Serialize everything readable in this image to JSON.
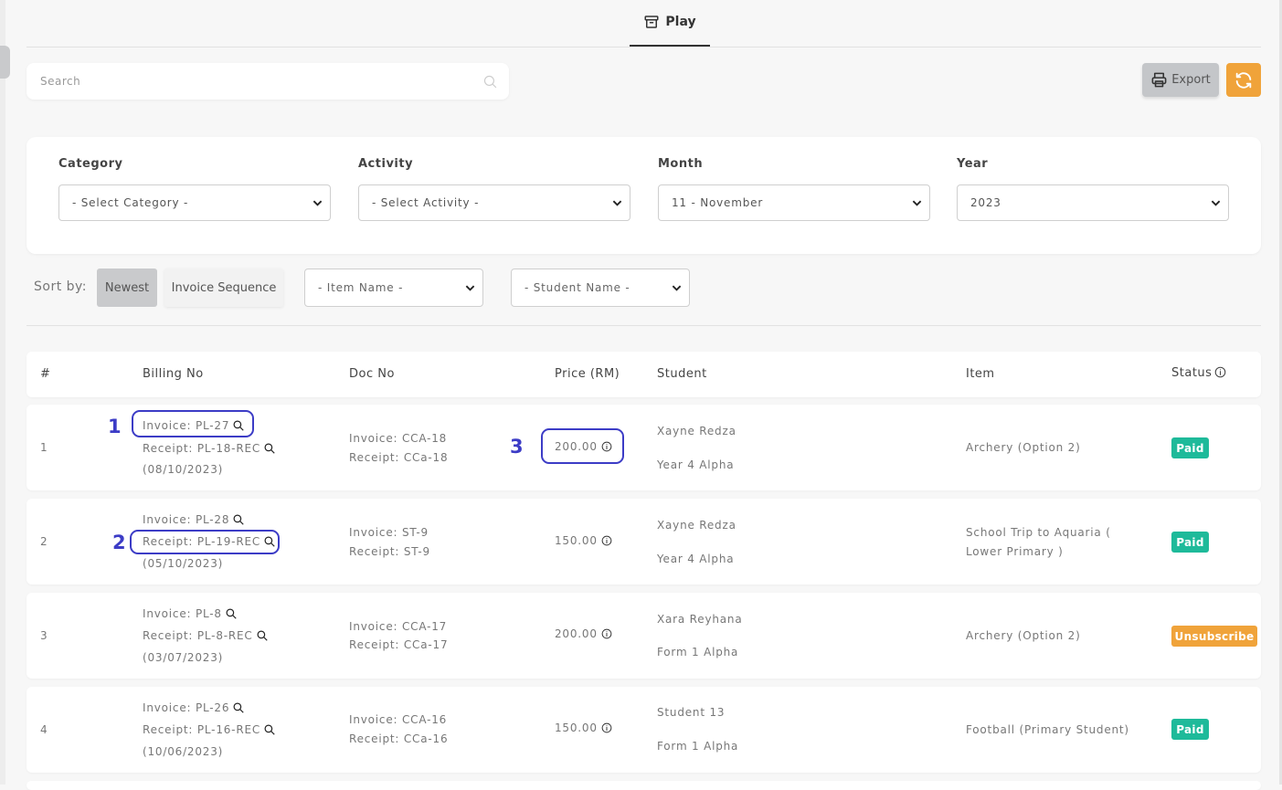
{
  "tab": {
    "label": "Play"
  },
  "search": {
    "placeholder": "Search"
  },
  "toolbar": {
    "export_label": "Export"
  },
  "colors": {
    "accent_orange": "#f0a33a",
    "paid_green": "#1eba9a",
    "highlight_blue": "#3c3cc6"
  },
  "filters": {
    "category": {
      "label": "Category",
      "value": "- Select Category -"
    },
    "activity": {
      "label": "Activity",
      "value": "- Select Activity -"
    },
    "month": {
      "label": "Month",
      "value": "11 - November"
    },
    "year": {
      "label": "Year",
      "value": "2023"
    }
  },
  "sort": {
    "label": "Sort by:",
    "newest": "Newest",
    "invoice_sequence": "Invoice Sequence",
    "item_name": "- Item Name -",
    "student_name": "- Student Name -"
  },
  "table": {
    "headers": {
      "index": "#",
      "billing_no": "Billing No",
      "doc_no": "Doc No",
      "price": "Price (RM)",
      "student": "Student",
      "item": "Item",
      "status": "Status"
    },
    "rows": [
      {
        "index": "1",
        "invoice": "Invoice: PL-27",
        "receipt": "Receipt: PL-18-REC",
        "date": "(08/10/2023)",
        "doc_invoice": "Invoice: CCA-18",
        "doc_receipt": "Receipt: CCa-18",
        "price": "200.00",
        "student_name": "Xayne Redza",
        "student_class": "Year 4 Alpha",
        "item": "Archery (Option 2)",
        "item_line2": "",
        "status": "Paid"
      },
      {
        "index": "2",
        "invoice": "Invoice: PL-28",
        "receipt": "Receipt: PL-19-REC",
        "date": "(05/10/2023)",
        "doc_invoice": "Invoice: ST-9",
        "doc_receipt": "Receipt: ST-9",
        "price": "150.00",
        "student_name": "Xayne Redza",
        "student_class": "Year 4 Alpha",
        "item": "School Trip to Aquaria (",
        "item_line2": "Lower Primary )",
        "status": "Paid"
      },
      {
        "index": "3",
        "invoice": "Invoice: PL-8",
        "receipt": "Receipt: PL-8-REC",
        "date": "(03/07/2023)",
        "doc_invoice": "Invoice: CCA-17",
        "doc_receipt": "Receipt: CCa-17",
        "price": "200.00",
        "student_name": "Xara Reyhana",
        "student_class": "Form 1 Alpha",
        "item": "Archery (Option 2)",
        "item_line2": "",
        "status": "Unsubscribe"
      },
      {
        "index": "4",
        "invoice": "Invoice: PL-26",
        "receipt": "Receipt: PL-16-REC",
        "date": "(10/06/2023)",
        "doc_invoice": "Invoice: CCA-16",
        "doc_receipt": "Receipt: CCa-16",
        "price": "150.00",
        "student_name": "Student 13",
        "student_class": "Form 1 Alpha",
        "item": "Football (Primary Student)",
        "item_line2": "",
        "status": "Paid"
      }
    ]
  },
  "annotations": [
    "1",
    "2",
    "3"
  ]
}
